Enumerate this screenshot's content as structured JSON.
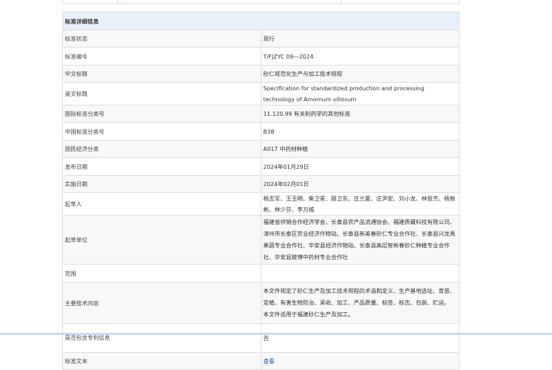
{
  "section_title": "标准详细信息",
  "rows": [
    {
      "label": "标准状态",
      "value": "现行"
    },
    {
      "label": "标准编号",
      "value": "T/FJZYC 09—2024"
    },
    {
      "label": "中文标题",
      "value": "砂仁规范化生产与加工技术规程"
    },
    {
      "label": "英文标题",
      "value": "Specification for standardized production and processing technology of Amomum villosum"
    },
    {
      "label": "国际标准分类号",
      "value": "11.120.99 有关制药学的其他标准"
    },
    {
      "label": "中国标准分类号",
      "value": "B38"
    },
    {
      "label": "国民经济分类",
      "value": "A017 中药材种植"
    },
    {
      "label": "发布日期",
      "value": "2024年01月29日"
    },
    {
      "label": "实施日期",
      "value": "2024年02月01日"
    },
    {
      "label": "起草人",
      "value": "杨志军、王玉明、柴卫星、薛卫东、庄兰夏、庄尹宏、刘小龙、林俊杰、杨智彬、林少芬、李万城"
    },
    {
      "label": "起草单位",
      "value": "福建省供销合作经济学会、长泰县农产品流通协会、福建质藏科技有限公司、漳州市长泰区农业经济作物站、长泰县新美春砂仁专业合作社、长泰县兴龙禹果蔬专业合作社、华安县经济作物站、长泰县高层智彬春砂仁种植专业合作社、华安县陂博中药材专业合作社"
    },
    {
      "label": "范围",
      "value": ""
    },
    {
      "label": "主要技术内容",
      "value": "本文件规定了砂仁生产及加工技术规程的术语和定义、生产基地选址、育苗、定植、有害生物防治、采收、加工、产品质量、标签、标志、包装、贮运。",
      "value2": "本文件适用于福建砂仁生产及加工。"
    },
    {
      "label": "是否包含专利信息",
      "value": "否"
    },
    {
      "label": "标准文本",
      "value": "查看"
    }
  ]
}
